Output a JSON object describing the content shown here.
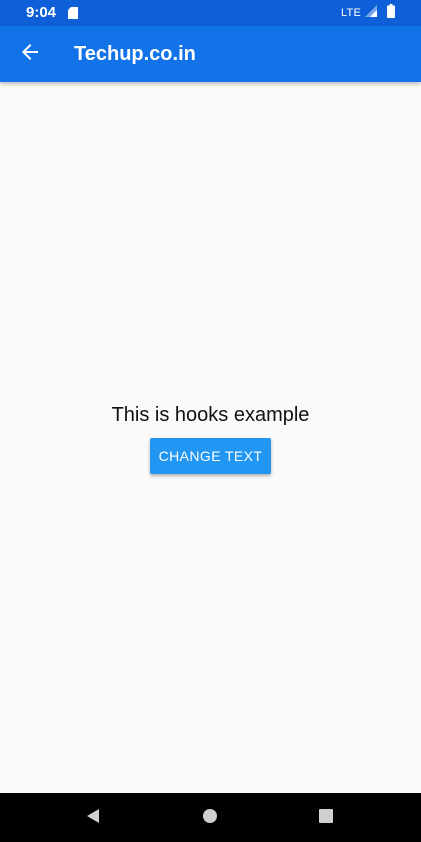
{
  "status_bar": {
    "time": "9:04",
    "network": "LTE",
    "sd_icon": "sd-card-icon",
    "signal_icon": "cell-signal-icon",
    "battery_icon": "battery-icon"
  },
  "app_bar": {
    "title": "Techup.co.in",
    "back_icon": "arrow-back-icon",
    "color": "#1273e9"
  },
  "main": {
    "message": "This is hooks example",
    "button_label": "CHANGE TEXT",
    "button_color": "#2196f3"
  },
  "nav_bar": {
    "back_icon": "nav-back-triangle-icon",
    "home_icon": "nav-home-circle-icon",
    "recents_icon": "nav-recents-square-icon"
  }
}
